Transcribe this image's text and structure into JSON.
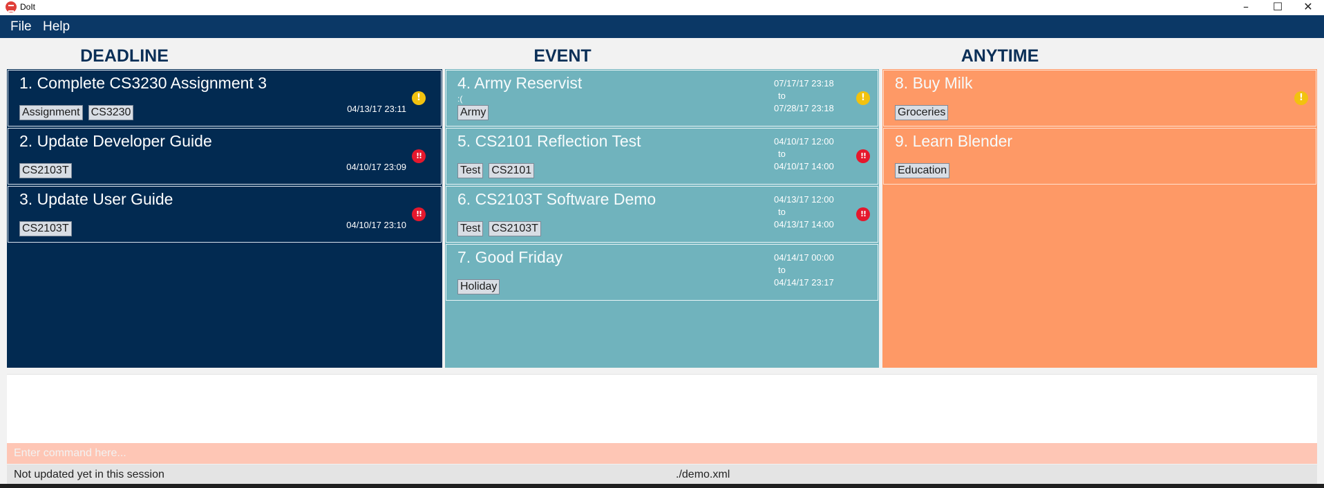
{
  "window": {
    "title": "DoIt"
  },
  "menu": {
    "items": [
      "File",
      "Help"
    ]
  },
  "columns": {
    "deadline": {
      "header": "DEADLINE",
      "tasks": [
        {
          "title": "1. Complete CS3230 Assignment 3",
          "tags": [
            "Assignment",
            "CS3230"
          ],
          "date": "04/13/17 23:11",
          "priority": "medium",
          "priority_glyph": "!"
        },
        {
          "title": "2. Update Developer Guide",
          "tags": [
            "CS2103T"
          ],
          "date": "04/10/17 23:09",
          "priority": "high",
          "priority_glyph": "!!"
        },
        {
          "title": "3. Update User Guide",
          "tags": [
            "CS2103T"
          ],
          "date": "04/10/17 23:10",
          "priority": "high",
          "priority_glyph": "!!"
        }
      ]
    },
    "event": {
      "header": "EVENT",
      "tasks": [
        {
          "title": "4. Army Reservist",
          "description": ":(",
          "tags": [
            "Army"
          ],
          "start": "07/17/17 23:18",
          "to": "to",
          "end": "07/28/17 23:18",
          "priority": "medium",
          "priority_glyph": "!"
        },
        {
          "title": "5. CS2101 Reflection Test",
          "tags": [
            "Test",
            "CS2101"
          ],
          "start": "04/10/17 12:00",
          "to": "to",
          "end": "04/10/17 14:00",
          "priority": "high",
          "priority_glyph": "!!"
        },
        {
          "title": "6. CS2103T Software Demo",
          "tags": [
            "Test",
            "CS2103T"
          ],
          "start": "04/13/17 12:00",
          "to": "to",
          "end": "04/13/17 14:00",
          "priority": "high",
          "priority_glyph": "!!"
        },
        {
          "title": "7. Good Friday",
          "tags": [
            "Holiday"
          ],
          "start": "04/14/17 00:00",
          "to": "to",
          "end": "04/14/17 23:17",
          "priority": "none"
        }
      ]
    },
    "anytime": {
      "header": "ANYTIME",
      "tasks": [
        {
          "title": "8. Buy Milk",
          "tags": [
            "Groceries"
          ],
          "priority": "medium",
          "priority_glyph": "!"
        },
        {
          "title": "9. Learn Blender",
          "tags": [
            "Education"
          ],
          "priority": "none"
        }
      ]
    }
  },
  "command": {
    "placeholder": "Enter command here...",
    "value": ""
  },
  "status": {
    "sync": "Not updated yet in this session",
    "file": "./demo.xml"
  },
  "colors": {
    "menubar": "#0b3866",
    "deadline_bg": "#022a51",
    "event_bg": "#70b3bd",
    "anytime_bg": "#fe9966",
    "command_bg": "#fec6b5",
    "priority_medium": "#f2c20f",
    "priority_high": "#e5182d"
  }
}
